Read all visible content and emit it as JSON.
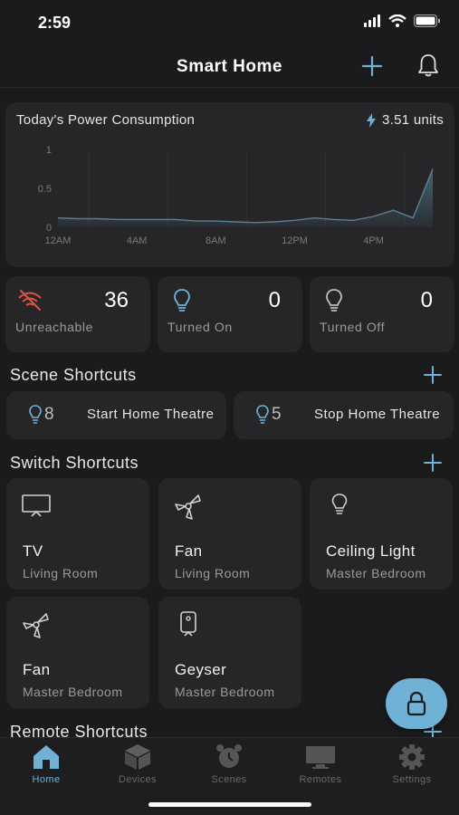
{
  "status_bar": {
    "time": "2:59"
  },
  "header": {
    "title": "Smart Home"
  },
  "power": {
    "title": "Today's Power Consumption",
    "value": "3.51 units",
    "chart_data": {
      "type": "area",
      "yticks": [
        "1",
        "0.5",
        "0"
      ],
      "xticks": [
        "12AM",
        "4AM",
        "8AM",
        "12PM",
        "4PM"
      ],
      "ylim": [
        0,
        1
      ],
      "xlim": [
        0,
        19
      ],
      "x": [
        0,
        1,
        2,
        3,
        4,
        5,
        6,
        7,
        8,
        9,
        10,
        11,
        12,
        13,
        14,
        15,
        16,
        17,
        18,
        19
      ],
      "y": [
        0.12,
        0.11,
        0.11,
        0.1,
        0.1,
        0.1,
        0.1,
        0.08,
        0.08,
        0.07,
        0.06,
        0.07,
        0.09,
        0.12,
        0.1,
        0.09,
        0.14,
        0.22,
        0.12,
        0.75
      ],
      "grid": true
    }
  },
  "stats": [
    {
      "count": "36",
      "label": "Unreachable"
    },
    {
      "count": "0",
      "label": "Turned On"
    },
    {
      "count": "0",
      "label": "Turned Off"
    }
  ],
  "scene_section": {
    "title": "Scene Shortcuts"
  },
  "scenes": [
    {
      "count": "8",
      "name": "Start Home Theatre"
    },
    {
      "count": "5",
      "name": "Stop Home Theatre"
    }
  ],
  "switch_section": {
    "title": "Switch Shortcuts"
  },
  "switches": [
    {
      "name": "TV",
      "room": "Living Room",
      "icon": "tv-icon"
    },
    {
      "name": "Fan",
      "room": "Living Room",
      "icon": "fan-icon"
    },
    {
      "name": "Ceiling Light",
      "room": "Master Bedroom",
      "icon": "bulb-icon"
    },
    {
      "name": "Fan",
      "room": "Master Bedroom",
      "icon": "fan-icon"
    },
    {
      "name": "Geyser",
      "room": "Master Bedroom",
      "icon": "geyser-icon"
    }
  ],
  "remote_section": {
    "title": "Remote Shortcuts"
  },
  "tabs": [
    {
      "label": "Home",
      "icon": "home-icon",
      "active": true
    },
    {
      "label": "Devices",
      "icon": "cube-icon",
      "active": false
    },
    {
      "label": "Scenes",
      "icon": "alarm-clock-icon",
      "active": false
    },
    {
      "label": "Remotes",
      "icon": "monitor-icon",
      "active": false
    },
    {
      "label": "Settings",
      "icon": "gear-icon",
      "active": false
    }
  ],
  "colors": {
    "accent": "#6fb2d6",
    "background": "#1b1b1d",
    "card": "#262628"
  }
}
